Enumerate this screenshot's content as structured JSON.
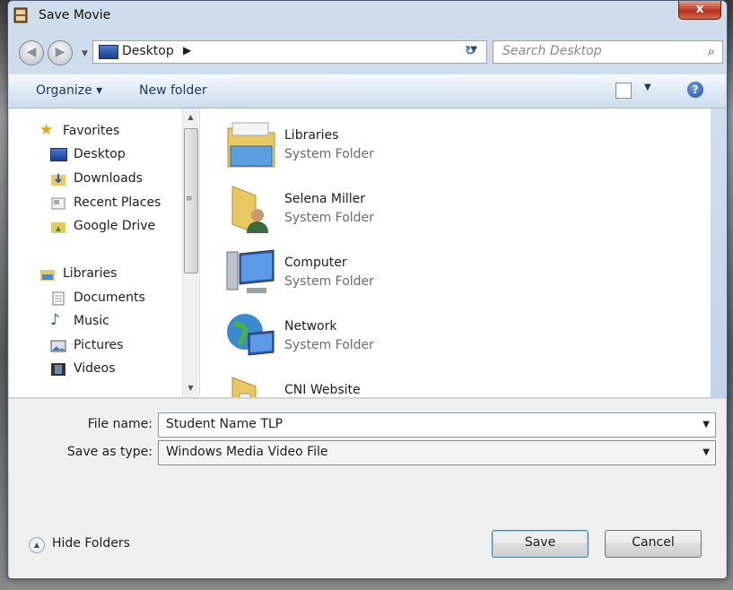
{
  "window": {
    "title": "Save Movie",
    "close_glyph": "x"
  },
  "address": {
    "location": "Desktop",
    "search_placeholder": "Search Desktop"
  },
  "toolbar": {
    "organize_label": "Organize ▾",
    "new_folder_label": "New folder"
  },
  "nav": {
    "favorites_label": "Favorites",
    "favorites": [
      "Desktop",
      "Downloads",
      "Recent Places",
      "Google Drive"
    ],
    "libraries_label": "Libraries",
    "libraries": [
      "Documents",
      "Music",
      "Pictures",
      "Videos"
    ]
  },
  "files": [
    {
      "name": "Libraries",
      "type": "System Folder",
      "icon": "libraries-folder-icon"
    },
    {
      "name": "Selena Miller",
      "type": "System Folder",
      "icon": "user-folder-icon"
    },
    {
      "name": "Computer",
      "type": "System Folder",
      "icon": "computer-icon"
    },
    {
      "name": "Network",
      "type": "System Folder",
      "icon": "network-icon"
    },
    {
      "name": "CNI Website",
      "type": "",
      "icon": "folder-icon"
    }
  ],
  "form": {
    "file_name_label": "File name:",
    "file_name_value": "Student Name TLP",
    "save_type_label": "Save as type:",
    "save_type_value": "Windows Media Video File"
  },
  "footer": {
    "hide_folders_label": "Hide Folders",
    "save_label": "Save",
    "cancel_label": "Cancel"
  },
  "colors": {
    "accent": "#3c7fb1",
    "toolbar_text": "#1e395b"
  }
}
